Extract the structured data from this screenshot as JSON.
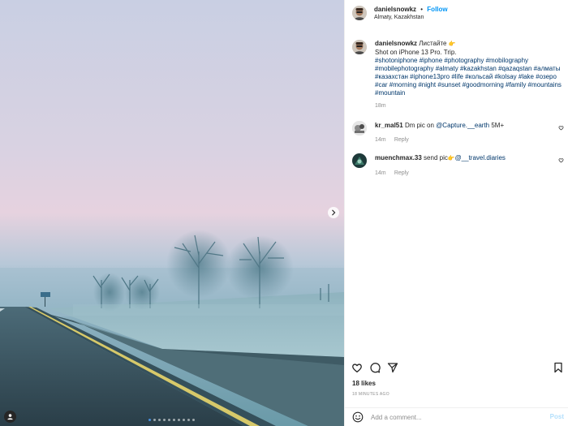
{
  "post": {
    "username": "danielsnowkz",
    "follow_label": "Follow",
    "separator": "•",
    "location": "Almaty, Kazakhstan"
  },
  "caption": {
    "username": "danielsnowkz",
    "text_head": "Листайте",
    "emoji": "👉",
    "line2": "Shot on iPhone 13 Pro. Trip.",
    "hashtags": "#shotoniphone #iphone #photography #mobilography #mobilephotography #almaty #kazakhstan #qazaqstan #алматы #казахстан #iphone13pro #life #кольсай #kolsay #lake #озеро #car #morning #night #sunset #goodmorning #family #mountains #mountain",
    "time": "18m"
  },
  "comments": [
    {
      "username": "kr_mal51",
      "text": "Dm pic on",
      "mention": "@Capture.__earth",
      "tail": "5M+",
      "time": "14m",
      "reply_label": "Reply"
    },
    {
      "username": "muenchmax.33",
      "text": "send pic",
      "emoji": "👉",
      "mention": "@__travel.diaries",
      "time": "14m",
      "reply_label": "Reply"
    }
  ],
  "engagement": {
    "likes": "18 likes",
    "time_ago": "18 MINUTES AGO"
  },
  "comment_box": {
    "placeholder": "Add a comment...",
    "post_label": "Post"
  },
  "carousel": {
    "count": 10,
    "active_index": 0
  },
  "icons": {
    "next": "chevron-right-icon",
    "like": "heart-icon",
    "comment": "comment-icon",
    "share": "paper-plane-icon",
    "save": "bookmark-icon",
    "emoji": "smiley-icon",
    "tags": "user-tag-icon"
  },
  "colors": {
    "link": "#00376b",
    "accent": "#0095f6",
    "muted": "#8e8e8e"
  }
}
